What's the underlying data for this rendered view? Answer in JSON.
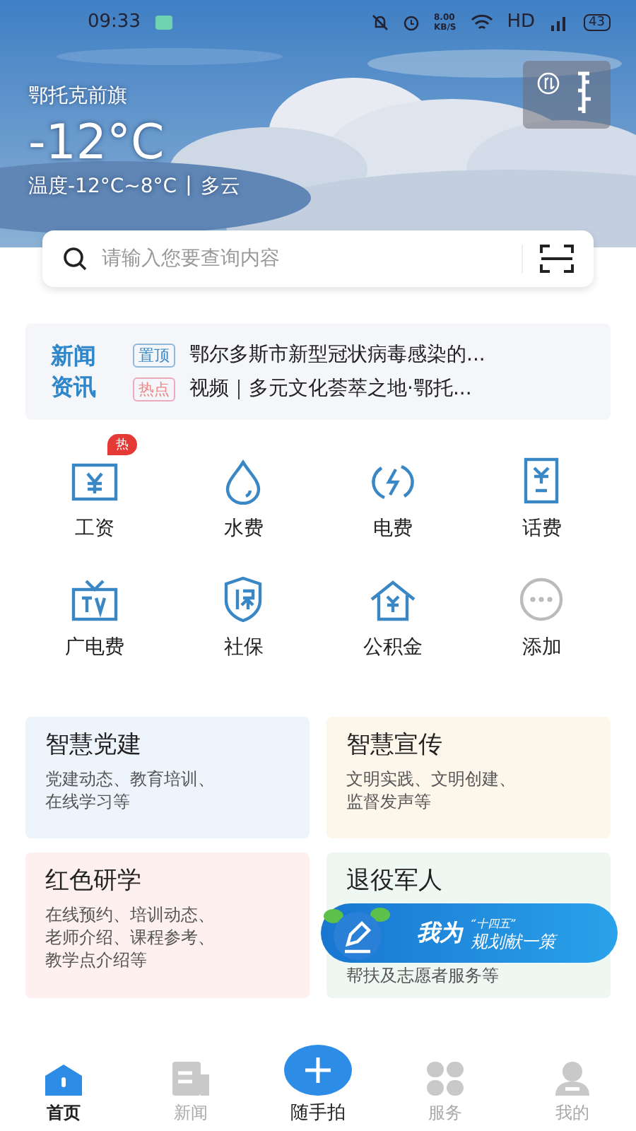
{
  "status_bar": {
    "time": "09:33",
    "speed": "8.00",
    "speed_unit": "KB/S",
    "network": "HD",
    "battery": "43"
  },
  "weather": {
    "city": "鄂托克前旗",
    "temperature": "-12°C",
    "range": "温度-12°C~8°C",
    "divider": "|",
    "condition": "多云"
  },
  "search": {
    "placeholder": "请输入您要查询内容"
  },
  "news": {
    "label": "新闻资讯",
    "items": [
      {
        "tag": "置顶",
        "kind": "top",
        "title": "鄂尔多斯市新型冠状病毒感染的..."
      },
      {
        "tag": "热点",
        "kind": "hot",
        "title": "视频｜多元文化荟萃之地·鄂托..."
      }
    ]
  },
  "services": [
    {
      "label": "工资",
      "kind": "salary",
      "badge": "热"
    },
    {
      "label": "水费",
      "kind": "water"
    },
    {
      "label": "电费",
      "kind": "power"
    },
    {
      "label": "话费",
      "kind": "phone"
    },
    {
      "label": "广电费",
      "kind": "tv"
    },
    {
      "label": "社保",
      "kind": "insurance"
    },
    {
      "label": "公积金",
      "kind": "fund"
    },
    {
      "label": "添加",
      "kind": "more"
    }
  ],
  "cards": [
    {
      "title": "智慧党建",
      "desc": "党建动态、教育培训、在线学习等",
      "color": "#eef4fc"
    },
    {
      "title": "智慧宣传",
      "desc": "文明实践、文明创建、监督发声等",
      "color": "#fdf6ea"
    },
    {
      "title": "红色研学",
      "desc": "在线预约、培训动态、老师介绍、课程参考、教学点介绍等",
      "color": "#fdf0ef"
    },
    {
      "title": "退役军人",
      "desc": "帮扶及志愿者服务等",
      "color": "#eef7f1"
    }
  ],
  "banner": {
    "lead": "我为",
    "mark": "“十四五”",
    "tail": "规划献一策"
  },
  "tabs": [
    {
      "label": "首页",
      "kind": "home",
      "selected": true
    },
    {
      "label": "新闻",
      "kind": "news",
      "selected": false
    },
    {
      "label": "随手拍",
      "kind": "camera",
      "selected": false
    },
    {
      "label": "服务",
      "kind": "service",
      "selected": false
    },
    {
      "label": "我的",
      "kind": "me",
      "selected": false
    }
  ]
}
